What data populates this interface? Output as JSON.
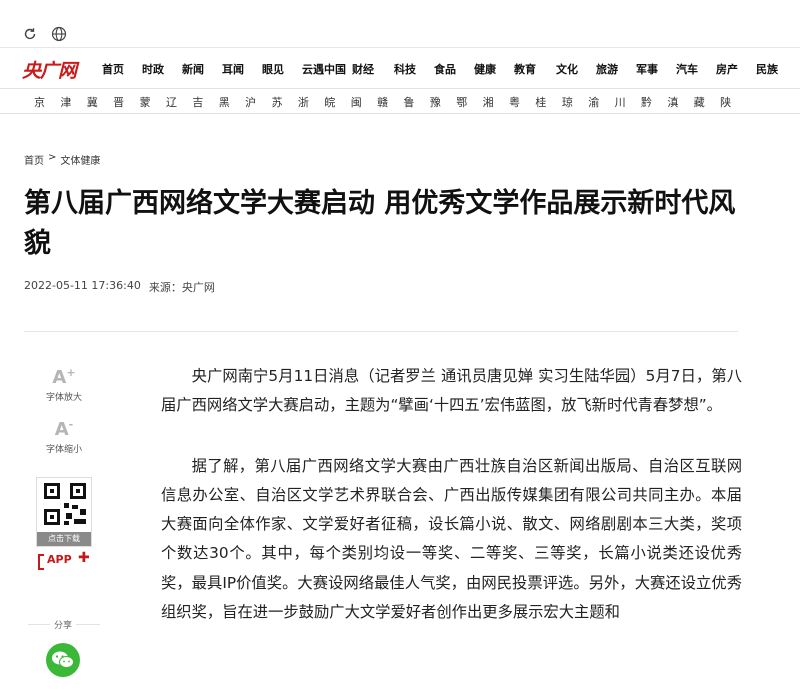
{
  "toolbar": {
    "reload_icon": "reload-icon",
    "globe_icon": "globe-icon"
  },
  "logo": {
    "text": "央广网"
  },
  "nav": [
    "首页",
    "时政",
    "新闻",
    "耳闻",
    "眼见",
    "云遇中国",
    "财经",
    "科技",
    "食品",
    "健康",
    "教育",
    "文化",
    "旅游",
    "军事",
    "汽车",
    "房产",
    "民族"
  ],
  "regions": [
    "京",
    "津",
    "冀",
    "晋",
    "蒙",
    "辽",
    "吉",
    "黑",
    "沪",
    "苏",
    "浙",
    "皖",
    "闽",
    "赣",
    "鲁",
    "豫",
    "鄂",
    "湘",
    "粤",
    "桂",
    "琼",
    "渝",
    "川",
    "黔",
    "滇",
    "藏",
    "陕"
  ],
  "breadcrumb": {
    "home": "首页",
    "sep": ">",
    "section": "文体健康"
  },
  "article": {
    "title": "第八届广西网络文学大赛启动 用优秀文学作品展示新时代风貌",
    "date": "2022-05-11 17:36:40",
    "source": "来源：央广网",
    "paragraphs": [
      "央广网南宁5月11日消息（记者罗兰 通讯员唐见婵 实习生陆华园）5月7日，第八届广西网络文学大赛启动，主题为“擘画‘十四五’宏伟蓝图，放飞新时代青春梦想”。",
      "据了解，第八届广西网络文学大赛由广西壮族自治区新闻出版局、自治区互联网信息办公室、自治区文学艺术界联合会、广西出版传媒集团有限公司共同主办。本届大赛面向全体作家、文学爱好者征稿，设长篇小说、散文、网络剧剧本三大类，奖项个数达30个。其中，每个类别均设一等奖、二等奖、三等奖，长篇小说类还设优秀奖，最具IP价值奖。大赛设网络最佳人气奖，由网民投票评选。另外，大赛还设立优秀组织奖，旨在进一步鼓励广大文学爱好者创作出更多展示宏大主题和"
    ]
  },
  "side": {
    "font_up_symbol": "A",
    "font_up_sup": "+",
    "font_up_label": "字体放大",
    "font_down_symbol": "A",
    "font_down_sup": "-",
    "font_down_label": "字体缩小",
    "qr_label": "点击下载",
    "app_label": "APP",
    "app_plus": "✚",
    "share_label": "分享",
    "wechat_icon": "wechat-icon"
  },
  "colors": {
    "brand_red": "#cc1a1a",
    "wechat_green": "#3bb838"
  }
}
